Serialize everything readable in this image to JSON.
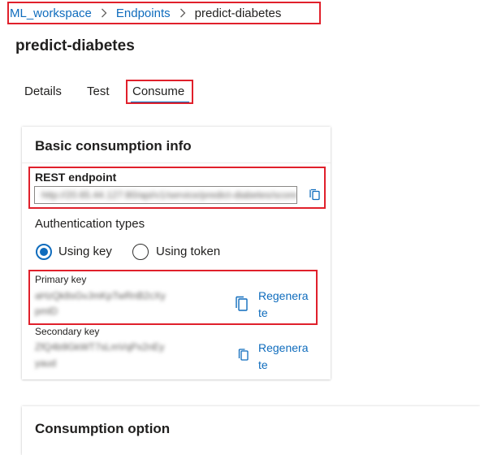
{
  "breadcrumb": {
    "workspace": "ML_workspace",
    "endpoints": "Endpoints",
    "current": "predict-diabetes"
  },
  "page_title": "predict-diabetes",
  "tabs": [
    {
      "label": "Details",
      "active": false
    },
    {
      "label": "Test",
      "active": false
    },
    {
      "label": "Consume",
      "active": true
    }
  ],
  "basic_info": {
    "title": "Basic consumption info",
    "rest_endpoint_label": "REST endpoint",
    "rest_endpoint_value": "http://20.65.44.127:80/api/v1/service/predict-diabetes/score",
    "auth_types_label": "Authentication types",
    "auth_options": [
      "Using key",
      "Using token"
    ],
    "auth_selected": "Using key",
    "primary_key_label": "Primary key",
    "primary_key_value_line1": "aHzQk8sGvJmKpTwRnB2cXy",
    "primary_key_value_line2": "pmlD",
    "secondary_key_label": "Secondary key",
    "secondary_key_value_line1": "ZfQ4b9GkWT7sLmVqPx2nEy",
    "secondary_key_value_line2": "yaud",
    "regenerate_line1": "Regenera",
    "regenerate_line2": "te"
  },
  "consumption_option": {
    "title": "Consumption option"
  },
  "colors": {
    "accent": "#0f6cbd",
    "highlight": "#e0202b"
  }
}
